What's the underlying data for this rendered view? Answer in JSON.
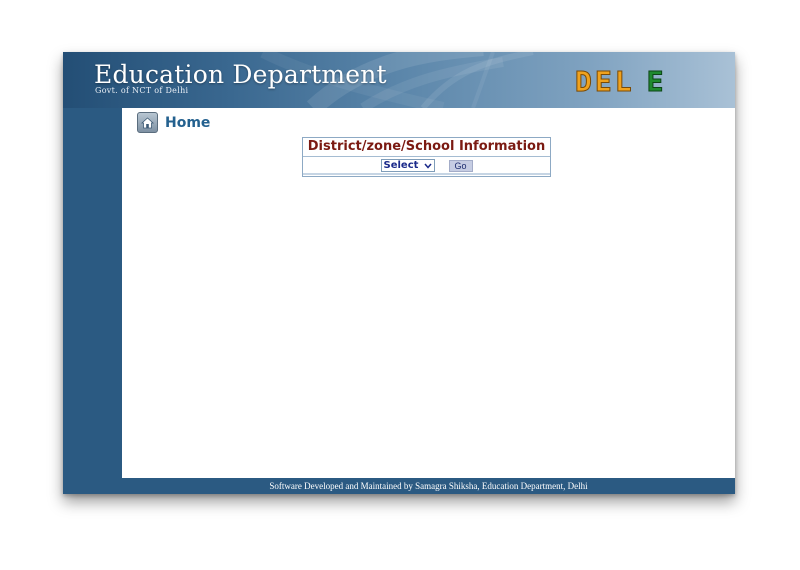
{
  "header": {
    "title": "Education Department",
    "subtitle": "Govt. of NCT of Delhi",
    "logo": {
      "text_primary": "DEL",
      "text_secondary": "E",
      "primary_color": "#f0a21d",
      "secondary_color": "#1f8a2f"
    }
  },
  "nav": {
    "home_label": "Home",
    "home_icon": "home-icon"
  },
  "info_panel": {
    "title": "District/zone/School Information",
    "select_value": "Select",
    "go_label": "Go"
  },
  "footer": {
    "text": "Software Developed and Maintained by Samagra Shiksha, Education Department, Delhi"
  },
  "colors": {
    "frame": "#2b5a82",
    "title_text": "#7b1a12",
    "home_text": "#24618f"
  }
}
